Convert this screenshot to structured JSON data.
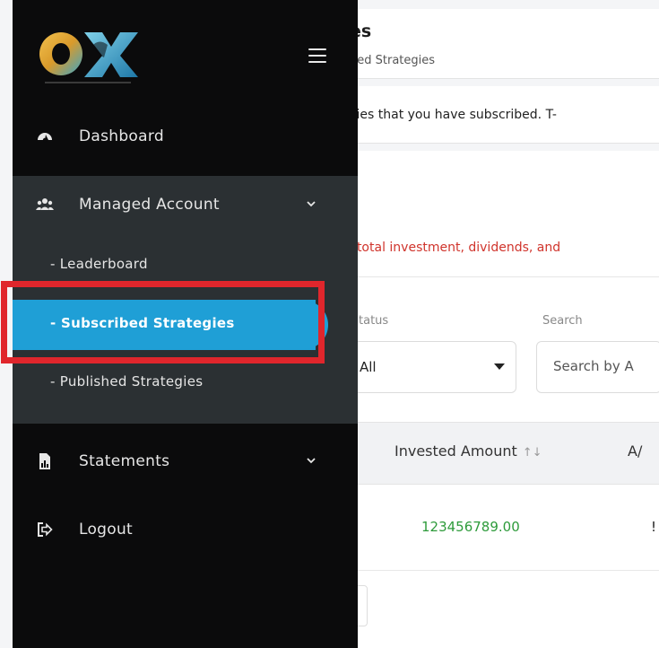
{
  "header": {
    "title": "es",
    "subtitle": "bed Strategies"
  },
  "info": {
    "text": "egies that you have subscribed. T-"
  },
  "warning": {
    "text": "of total investment, dividends, and"
  },
  "filters": {
    "status_label": "tatus",
    "status_value": "All",
    "search_label": "Search",
    "search_placeholder": "Search by A"
  },
  "table": {
    "headers": [
      "Invested Amount",
      "A/"
    ],
    "sort_glyph": "↑↓",
    "rows": [
      {
        "invested_amount": "123456789.00",
        "next": "!"
      }
    ]
  },
  "sidebar": {
    "items": [
      {
        "label": "Dashboard",
        "icon": "gauge-icon"
      },
      {
        "label": "Managed Account",
        "icon": "users-icon",
        "expanded": true,
        "children": [
          {
            "label": "- Leaderboard"
          },
          {
            "label": "- Subscribed Strategies",
            "active": true
          },
          {
            "label": "- Published Strategies"
          }
        ]
      },
      {
        "label": "Statements",
        "icon": "file-chart-icon"
      },
      {
        "label": "Logout",
        "icon": "logout-icon"
      }
    ]
  },
  "colors": {
    "sidebar_bg": "#0b0b0c",
    "submenu_bg": "#2b3033",
    "active_bg": "#1f9fd6",
    "highlight": "#e0262c",
    "warning_text": "#d0342c",
    "amount_text": "#2e9b3b"
  }
}
